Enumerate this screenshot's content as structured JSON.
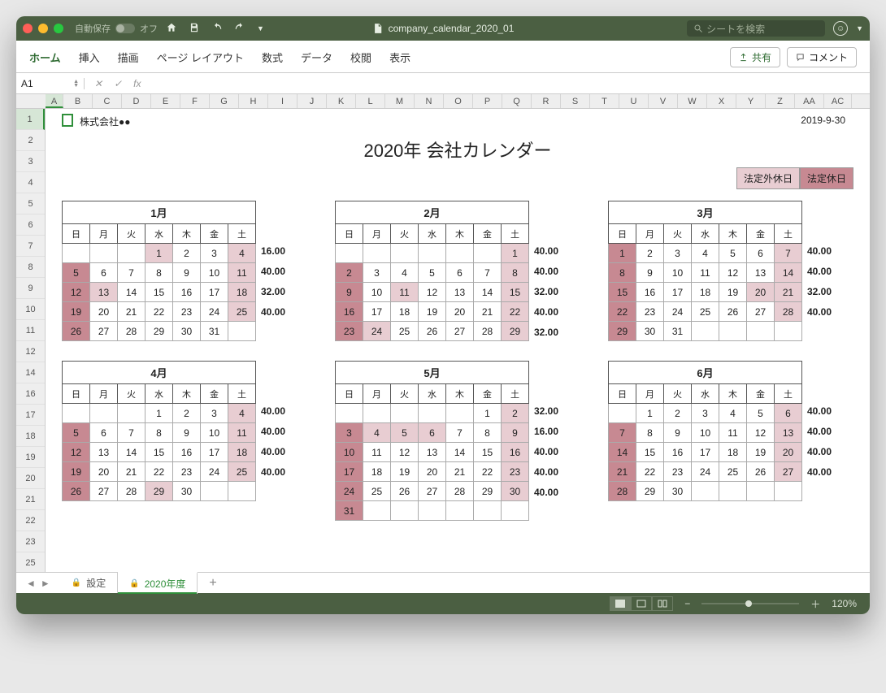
{
  "window": {
    "autosave_label": "自動保存",
    "autosave_state": "オフ",
    "filename": "company_calendar_2020_01",
    "search_placeholder": "シートを検索"
  },
  "ribbon": {
    "tabs": [
      "ホーム",
      "挿入",
      "描画",
      "ページ レイアウト",
      "数式",
      "データ",
      "校閲",
      "表示"
    ],
    "share": "共有",
    "comment": "コメント"
  },
  "formula": {
    "cell": "A1",
    "fx": "fx"
  },
  "columns": [
    "A",
    "B",
    "C",
    "D",
    "E",
    "F",
    "G",
    "H",
    "I",
    "J",
    "K",
    "L",
    "M",
    "N",
    "O",
    "P",
    "Q",
    "R",
    "S",
    "T",
    "U",
    "V",
    "W",
    "X",
    "Y",
    "Z",
    "AA",
    "AC"
  ],
  "rows": [
    "1",
    "2",
    "3",
    "4",
    "5",
    "6",
    "7",
    "8",
    "9",
    "10",
    "11",
    "12",
    "14",
    "16",
    "17",
    "18",
    "19",
    "20",
    "21",
    "22",
    "23",
    "25"
  ],
  "sheet": {
    "company": "株式会社●●",
    "date": "2019-9-30",
    "title": "2020年 会社カレンダー",
    "legend": {
      "nonstat": "法定外休日",
      "stat": "法定休日"
    },
    "daynames": [
      "日",
      "月",
      "火",
      "水",
      "木",
      "金",
      "土"
    ],
    "months": [
      {
        "name": "1月",
        "offset": 3,
        "days": 31,
        "stat": [
          5,
          12,
          19,
          26
        ],
        "nonstat": [
          1,
          4,
          11,
          13,
          18,
          25
        ],
        "hours": [
          "16.00",
          "40.00",
          "32.00",
          "40.00"
        ]
      },
      {
        "name": "2月",
        "offset": 6,
        "days": 29,
        "stat": [
          2,
          9,
          16,
          23
        ],
        "nonstat": [
          1,
          8,
          11,
          15,
          22,
          24,
          29
        ],
        "hours": [
          "40.00",
          "40.00",
          "32.00",
          "40.00",
          "32.00"
        ]
      },
      {
        "name": "3月",
        "offset": 0,
        "days": 31,
        "stat": [
          1,
          8,
          15,
          22,
          29
        ],
        "nonstat": [
          7,
          14,
          20,
          21,
          28
        ],
        "hours": [
          "40.00",
          "40.00",
          "32.00",
          "40.00"
        ]
      },
      {
        "name": "4月",
        "offset": 3,
        "days": 30,
        "stat": [
          5,
          12,
          19,
          26
        ],
        "nonstat": [
          4,
          11,
          18,
          25,
          29
        ],
        "hours": [
          "40.00",
          "40.00",
          "40.00",
          "40.00"
        ]
      },
      {
        "name": "5月",
        "offset": 5,
        "days": 31,
        "stat": [
          3,
          10,
          17,
          24,
          31
        ],
        "nonstat": [
          2,
          4,
          5,
          6,
          9,
          16,
          23,
          30
        ],
        "hours": [
          "32.00",
          "16.00",
          "40.00",
          "40.00",
          "40.00"
        ]
      },
      {
        "name": "6月",
        "offset": 1,
        "days": 30,
        "stat": [
          7,
          14,
          21,
          28
        ],
        "nonstat": [
          6,
          13,
          20,
          27
        ],
        "hours": [
          "40.00",
          "40.00",
          "40.00",
          "40.00"
        ]
      }
    ]
  },
  "tabs": {
    "arrows": [
      "◄",
      "►"
    ],
    "sheets": [
      {
        "label": "設定"
      },
      {
        "label": "2020年度",
        "current": true
      }
    ],
    "add": "+"
  },
  "status": {
    "zoom": "120%"
  }
}
